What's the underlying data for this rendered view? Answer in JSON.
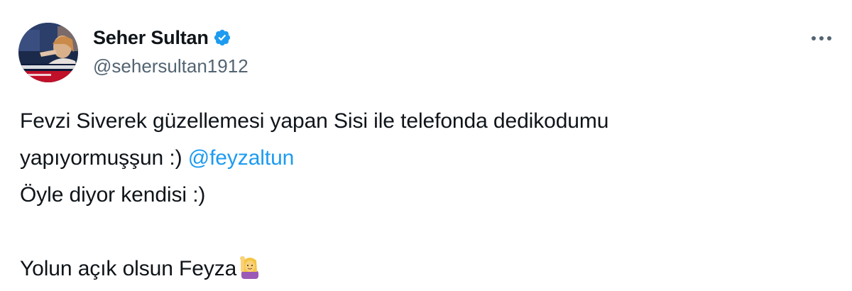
{
  "author": {
    "display_name": "Seher Sultan",
    "handle": "@sehersultan1912",
    "verified": true,
    "verified_color": "#1d9bf0"
  },
  "menu": {
    "icon": "more-horizontal-icon"
  },
  "tweet": {
    "line1": "Fevzi Siverek güzellemesi yapan Sisi ile telefonda dedikodumu",
    "line2_text": "yapıyormuşşun :) ",
    "mention": "@feyzaltun",
    "line3": "Öyle diyor kendisi :)",
    "line5": "Yolun açık olsun Feyza",
    "emoji": "person-raising-hand-emoji"
  },
  "colors": {
    "text": "#0f1419",
    "secondary": "#536471",
    "link": "#1d9bf0"
  }
}
